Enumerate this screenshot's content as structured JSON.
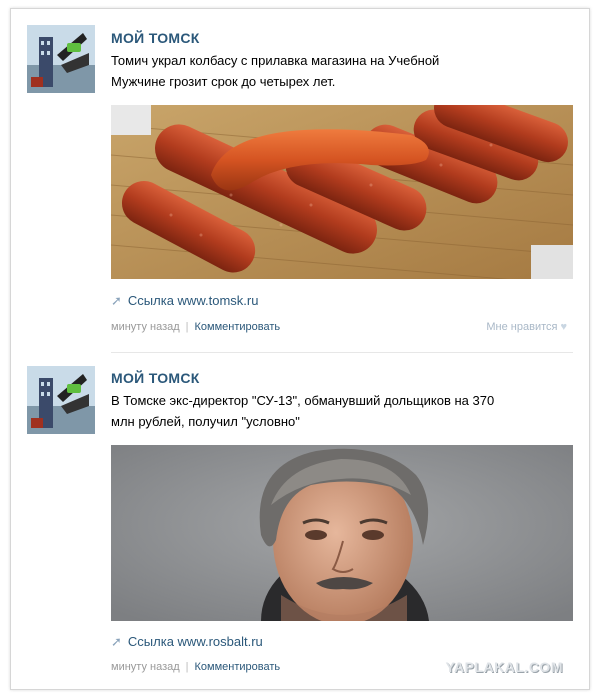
{
  "posts": [
    {
      "author": "МОЙ ТОМСК",
      "text_line1": "Томич украл колбасу с прилавка магазина на Учебной",
      "text_line2": "Мужчине грозит срок до четырех лет.",
      "link_icon": "link-arrow-icon",
      "link_text": "Ссылка www.tomsk.ru",
      "time": "минуту назад",
      "comment": "Комментировать",
      "like": "Мне нравится"
    },
    {
      "author": "МОЙ ТОМСК",
      "text_line1": "В Томске экс-директор \"СУ-13\", обманувший дольщиков на 370",
      "text_line2": "млн рублей, получил \"условно\"",
      "link_icon": "link-arrow-icon",
      "link_text": "Ссылка www.rosbalt.ru",
      "time": "минуту назад",
      "comment": "Комментировать"
    }
  ],
  "watermark": "YAPLAKAL.COM",
  "colors": {
    "link": "#2b587a",
    "meta": "#999999",
    "like": "#a9b8c7"
  }
}
